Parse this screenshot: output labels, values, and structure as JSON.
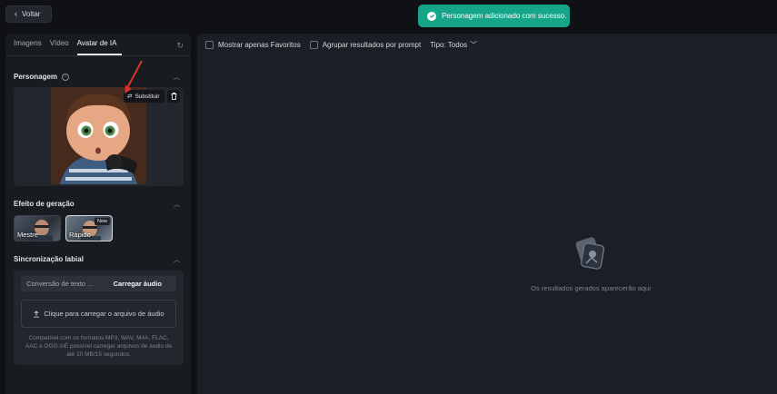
{
  "header": {
    "back_label": "Voltar"
  },
  "toast": {
    "message": "Personagem adicionado com sucesso."
  },
  "left_panel": {
    "tabs": [
      {
        "label": "Imagens"
      },
      {
        "label": "Vídeo"
      },
      {
        "label": "Avatar de IA"
      }
    ],
    "character": {
      "title": "Personagem",
      "replace_label": "Substituir"
    },
    "effect": {
      "title": "Efeito de geração",
      "options": [
        {
          "label": "Mestre"
        },
        {
          "label": "Rápido",
          "badge": "New"
        }
      ]
    },
    "lipsync": {
      "title": "Sincronização labial",
      "tabs": [
        {
          "label": "Conversão de texto ..."
        },
        {
          "label": "Carregar áudio"
        }
      ],
      "upload_label": "Clique para carregar o arquivo de áudio",
      "compat_text": "Compatível com os formatos MP3, WAV, M4A, FLAC, AAC e OGG.\\nÉ possível carregar arquivos de áudio de até 10 MB/15 segundos."
    }
  },
  "right_panel": {
    "filters": {
      "favorites_label": "Mostrar apenas Favoritos",
      "group_label": "Agrupar resultados por prompt",
      "type_label": "Tipo: Todos"
    },
    "empty_text": "Os resultados gerados aparecerão aqui"
  },
  "colors": {
    "toast_bg": "#17a58a",
    "panel_bg": "#181b20",
    "page_bg": "#0f1115"
  }
}
